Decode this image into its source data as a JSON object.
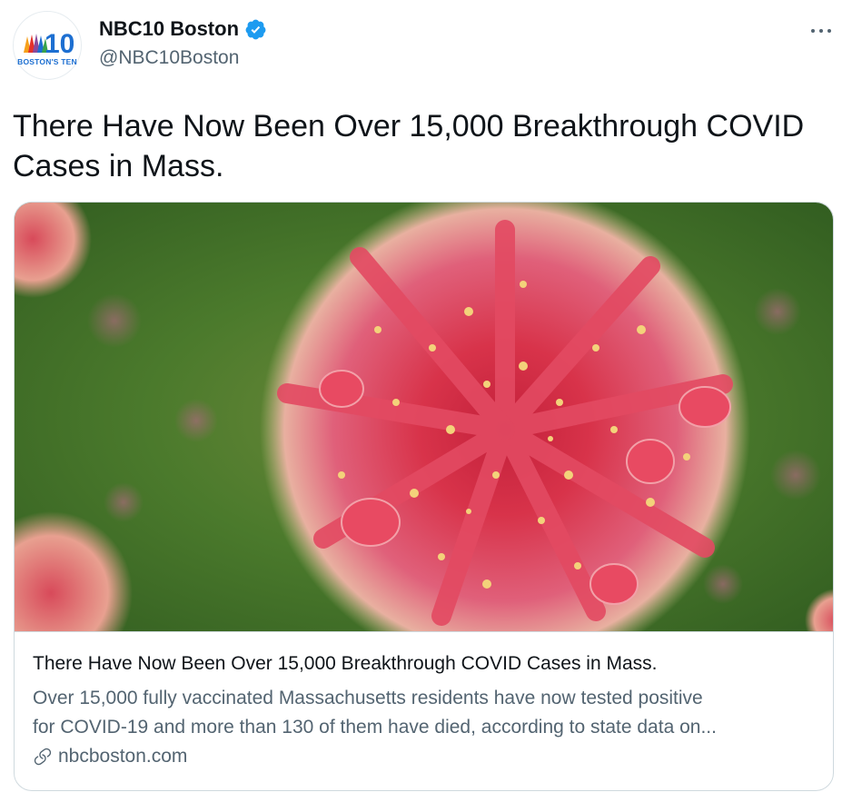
{
  "author": {
    "display_name": "NBC10 Boston",
    "handle": "@NBC10Boston",
    "logo_number": "10",
    "logo_caption": "BOSTON'S TEN",
    "verified": true
  },
  "tweet": {
    "text": "There Have Now Been Over 15,000 Breakthrough COVID Cases in Mass."
  },
  "card": {
    "title": "There Have Now Been Over 15,000 Breakthrough COVID Cases in Mass.",
    "description_line1": "Over 15,000 fully vaccinated Massachusetts residents have now tested positive",
    "description_line2": "for COVID-19 and more than 130 of them have died, according to state data on...",
    "domain": "nbcboston.com",
    "image": "coronavirus-particle-illustration"
  },
  "colors": {
    "text_primary": "#0f1419",
    "text_secondary": "#536471",
    "verified_blue": "#1d9bf0",
    "border": "#cfd9de"
  },
  "icons": [
    "verified-badge-icon",
    "more-options-icon",
    "link-icon"
  ]
}
